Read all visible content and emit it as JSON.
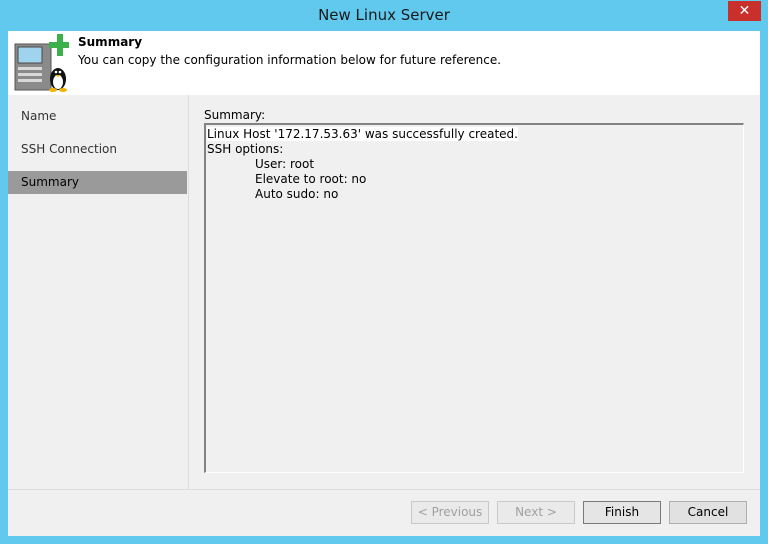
{
  "window": {
    "title": "New Linux Server",
    "close_label": "✕"
  },
  "header": {
    "title": "Summary",
    "subtitle": "You can copy the configuration information below for future reference."
  },
  "nav": {
    "items": [
      {
        "label": "Name"
      },
      {
        "label": "SSH Connection"
      },
      {
        "label": "Summary",
        "active": true
      }
    ]
  },
  "summary": {
    "label": "Summary:",
    "lines": [
      "Linux Host '172.17.53.63' was successfully created.",
      "SSH options:",
      "User: root",
      "Elevate to root: no",
      "Auto sudo: no"
    ]
  },
  "buttons": {
    "previous": "< Previous",
    "next": "Next >",
    "finish": "Finish",
    "cancel": "Cancel"
  },
  "colors": {
    "title_bar": "#62c9ee",
    "close_button": "#c9302c",
    "active_nav": "#9a9a9a",
    "plus_icon": "#3cb04a"
  }
}
